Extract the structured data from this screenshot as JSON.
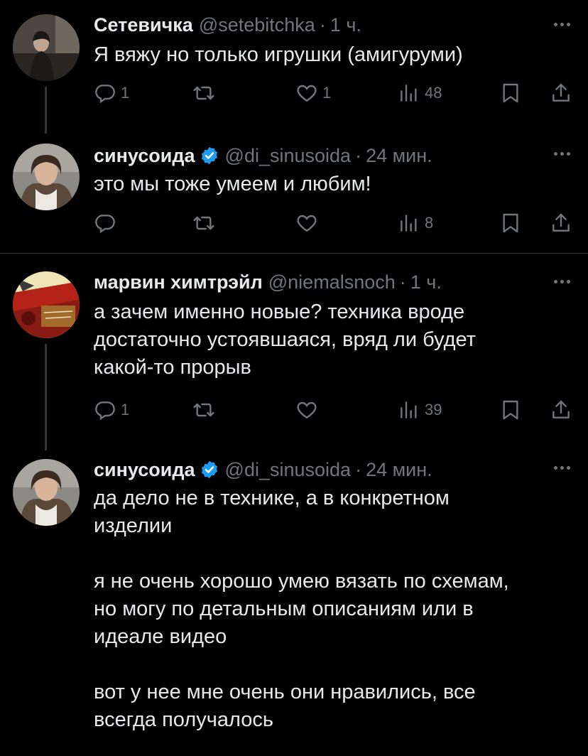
{
  "tweets": [
    {
      "name": "Сетевичка",
      "handle": "@setebitchka",
      "time": "1 ч.",
      "verified": false,
      "text": "Я вяжу но только игрушки (амигуруми)",
      "counts": {
        "reply": "1",
        "retweet": "",
        "like": "1",
        "views": "48"
      }
    },
    {
      "name": "синусоида",
      "handle": "@di_sinusoida",
      "time": "24 мин.",
      "verified": true,
      "text": "это мы тоже умеем и любим!",
      "counts": {
        "reply": "",
        "retweet": "",
        "like": "",
        "views": "8"
      }
    },
    {
      "name": "марвин химтрэйл",
      "handle": "@niemalsnoch",
      "time": "1 ч.",
      "verified": false,
      "text": "а зачем именно новые? техника вроде\nдостаточно устоявшаяся, вряд ли будет\nкакой-то прорыв",
      "counts": {
        "reply": "1",
        "retweet": "",
        "like": "",
        "views": "39"
      }
    },
    {
      "name": "синусоида",
      "handle": "@di_sinusoida",
      "time": "24 мин.",
      "verified": true,
      "text": "да дело не в технике, а в конкретном\nизделии\n\nя не очень хорошо умею вязать по схемам,\nно могу по детальным описаниям или в\nидеале видео\n\nвот у нее мне очень они нравились, все\nвсегда получалось"
    }
  ],
  "dot": "·",
  "colors": {
    "background": "#000000",
    "text": "#e7e9ea",
    "muted": "#71767b",
    "verified": "#1d9bf0",
    "divider": "#2f3336"
  },
  "icons": [
    "more-icon",
    "reply-icon",
    "retweet-icon",
    "like-icon",
    "views-icon",
    "bookmark-icon",
    "share-icon",
    "verified-badge-icon"
  ]
}
